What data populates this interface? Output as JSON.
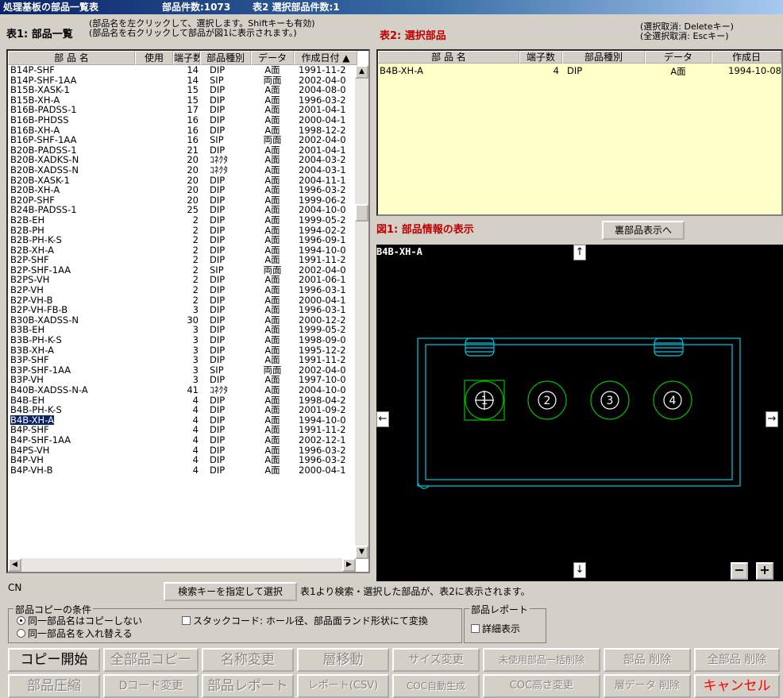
{
  "title": {
    "app": "処理基板の部品一覧表",
    "count": "部品件数:1073",
    "selected": "表2 選択部品件数:1"
  },
  "table1": {
    "title": "表1: 部品一覧",
    "note1": "(部品名を左クリックして、選択します。Shiftキーも有効)",
    "note2": "(部品名を右クリックして部品が図1に表示されます。)",
    "headers": [
      "部 品 名",
      "使用",
      "端子数",
      "部品種別",
      "データ",
      "作成日付"
    ],
    "rows": [
      [
        "B14P-SHF",
        "",
        "14",
        "DIP",
        "A面",
        "1991-11-2"
      ],
      [
        "B14P-SHF-1AA",
        "",
        "14",
        "SIP",
        "両面",
        "2002-04-0"
      ],
      [
        "B15B-XASK-1",
        "",
        "15",
        "DIP",
        "A面",
        "2004-08-0"
      ],
      [
        "B15B-XH-A",
        "",
        "15",
        "DIP",
        "A面",
        "1996-03-2"
      ],
      [
        "B16B-PADSS-1",
        "",
        "17",
        "DIP",
        "A面",
        "2001-04-1"
      ],
      [
        "B16B-PHDSS",
        "",
        "16",
        "DIP",
        "A面",
        "2000-04-1"
      ],
      [
        "B16B-XH-A",
        "",
        "16",
        "DIP",
        "A面",
        "1998-12-2"
      ],
      [
        "B16P-SHF-1AA",
        "",
        "16",
        "SIP",
        "両面",
        "2002-04-0"
      ],
      [
        "B20B-PADSS-1",
        "",
        "21",
        "DIP",
        "A面",
        "2001-04-1"
      ],
      [
        "B20B-XADKS-N",
        "",
        "20",
        "ｺﾈｸﾀ",
        "A面",
        "2004-03-2"
      ],
      [
        "B20B-XADSS-N",
        "",
        "20",
        "ｺﾈｸﾀ",
        "A面",
        "2004-03-1"
      ],
      [
        "B20B-XASK-1",
        "",
        "20",
        "DIP",
        "A面",
        "2004-11-1"
      ],
      [
        "B20B-XH-A",
        "",
        "20",
        "DIP",
        "A面",
        "1996-03-2"
      ],
      [
        "B20P-SHF",
        "",
        "20",
        "DIP",
        "A面",
        "1999-06-2"
      ],
      [
        "B24B-PADSS-1",
        "",
        "25",
        "DIP",
        "A面",
        "2004-10-0"
      ],
      [
        "B2B-EH",
        "",
        "2",
        "DIP",
        "A面",
        "1999-05-2"
      ],
      [
        "B2B-PH",
        "",
        "2",
        "DIP",
        "A面",
        "1994-02-2"
      ],
      [
        "B2B-PH-K-S",
        "",
        "2",
        "DIP",
        "A面",
        "1996-09-1"
      ],
      [
        "B2B-XH-A",
        "",
        "2",
        "DIP",
        "A面",
        "1994-10-0"
      ],
      [
        "B2P-SHF",
        "",
        "2",
        "DIP",
        "A面",
        "1991-11-2"
      ],
      [
        "B2P-SHF-1AA",
        "",
        "2",
        "SIP",
        "両面",
        "2002-04-0"
      ],
      [
        "B2PS-VH",
        "",
        "2",
        "DIP",
        "A面",
        "2001-06-1"
      ],
      [
        "B2P-VH",
        "",
        "2",
        "DIP",
        "A面",
        "1996-03-1"
      ],
      [
        "B2P-VH-B",
        "",
        "2",
        "DIP",
        "A面",
        "2000-04-1"
      ],
      [
        "B2P-VH-FB-B",
        "",
        "3",
        "DIP",
        "A面",
        "1996-03-1"
      ],
      [
        "B30B-XADSS-N",
        "",
        "30",
        "DIP",
        "A面",
        "2000-12-2"
      ],
      [
        "B3B-EH",
        "",
        "3",
        "DIP",
        "A面",
        "1999-05-2"
      ],
      [
        "B3B-PH-K-S",
        "",
        "3",
        "DIP",
        "A面",
        "1998-09-0"
      ],
      [
        "B3B-XH-A",
        "",
        "3",
        "DIP",
        "A面",
        "1995-12-2"
      ],
      [
        "B3P-SHF",
        "",
        "3",
        "DIP",
        "A面",
        "1991-11-2"
      ],
      [
        "B3P-SHF-1AA",
        "",
        "3",
        "SIP",
        "両面",
        "2002-04-0"
      ],
      [
        "B3P-VH",
        "",
        "3",
        "DIP",
        "A面",
        "1997-10-0"
      ],
      [
        "B40B-XADSS-N-A",
        "",
        "41",
        "ｺﾈｸﾀ",
        "A面",
        "2004-10-0"
      ],
      [
        "B4B-EH",
        "",
        "4",
        "DIP",
        "A面",
        "1998-04-2"
      ],
      [
        "B4B-PH-K-S",
        "",
        "4",
        "DIP",
        "A面",
        "2001-09-2"
      ],
      [
        "B4B-XH-A",
        "",
        "4",
        "DIP",
        "A面",
        "1994-10-0"
      ],
      [
        "B4P-SHF",
        "",
        "4",
        "DIP",
        "A面",
        "1991-11-2"
      ],
      [
        "B4P-SHF-1AA",
        "",
        "4",
        "DIP",
        "A面",
        "2002-12-1"
      ],
      [
        "B4PS-VH",
        "",
        "4",
        "DIP",
        "A面",
        "1996-03-2"
      ],
      [
        "B4P-VH",
        "",
        "4",
        "DIP",
        "A面",
        "1996-03-2"
      ],
      [
        "B4P-VH-B",
        "",
        "4",
        "DIP",
        "A面",
        "2000-04-1"
      ]
    ],
    "selected_index": 35
  },
  "table2": {
    "title": "表2: 選択部品",
    "note1": "(選択取消: Deleteキー)",
    "note2": "(全選択取消: Escキー)",
    "headers": [
      "部 品 名",
      "端子数",
      "部品種別",
      "データ",
      "作成日"
    ],
    "row": [
      "B4B-XH-A",
      "4",
      "DIP",
      "A面",
      "1994-10-08"
    ]
  },
  "figure": {
    "title": "図1: 部品情報の表示",
    "back_button": "裏部品表示へ",
    "part_label": "B4B-XH-A",
    "pins": [
      "1",
      "2",
      "3",
      "4"
    ],
    "arrows": {
      "up": "↑",
      "down": "↓",
      "left": "←",
      "right": "→"
    },
    "zoom_out": "−",
    "zoom_in": "+",
    "colors": {
      "outline": "#00c8e8",
      "pad": "#00c000",
      "background": "#000000"
    }
  },
  "bottom": {
    "cn": "CN",
    "search_button": "検索キーを指定して選択",
    "search_note": "表1より検索・選択した部品が、表2に表示されます。",
    "copy_group": {
      "legend": "部品コピーの条件",
      "radio1": "同一部品名はコピーしない",
      "radio2": "同一部品名を入れ替える",
      "check": "スタックコード: ホール径、部品面ランド形状にて変換"
    },
    "report_group": {
      "legend": "部品レポート",
      "check": "詳細表示"
    },
    "buttons_row1": [
      "コピー開始",
      "全部品コピー",
      "名称変更",
      "層移動",
      "サイズ変更",
      "未使用部品一括削除",
      "部品 削除",
      "全部品 削除"
    ],
    "buttons_row2": [
      "部品圧縮",
      "Dコード変更",
      "部品レポート",
      "レポート(CSV)",
      "COC自動生成",
      "COC高さ変更",
      "層データ 削除",
      "キャンセル"
    ]
  }
}
